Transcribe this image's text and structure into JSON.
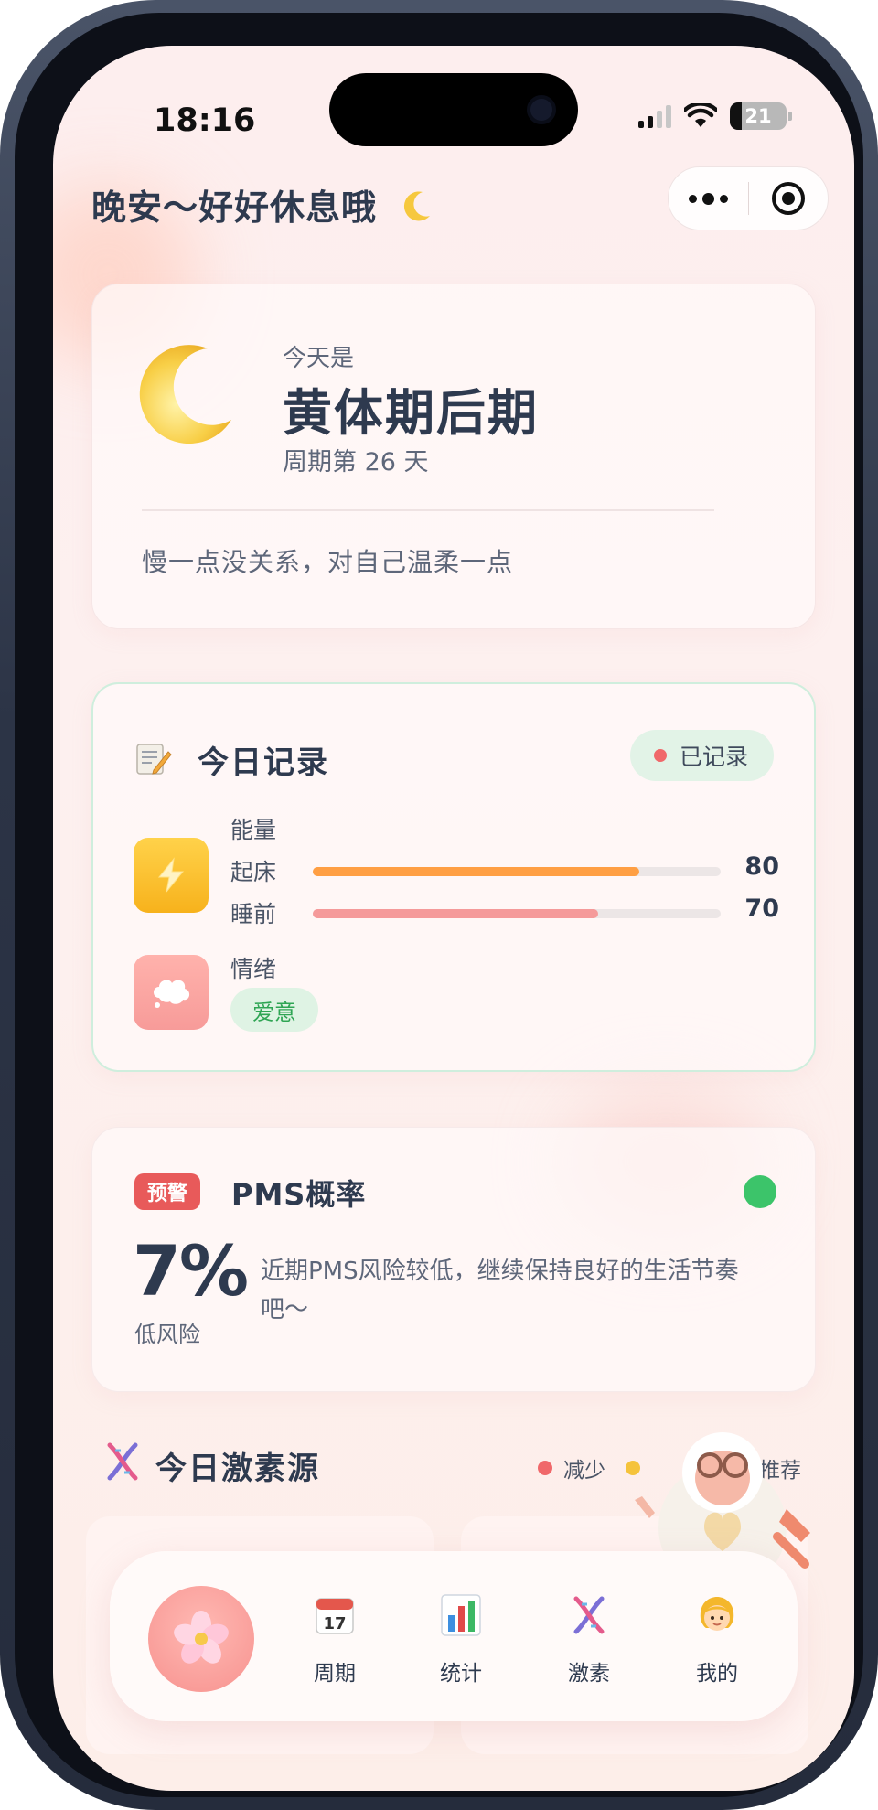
{
  "status_bar": {
    "time": "18:16",
    "battery": "21"
  },
  "header": {
    "greeting": "晚安～好好休息哦"
  },
  "phase": {
    "label": "今天是",
    "name": "黄体期后期",
    "day_text": "周期第 26 天",
    "quote": "慢一点没关系，对自己温柔一点"
  },
  "record": {
    "title": "今日记录",
    "badge": "已记录",
    "energy_label": "能量",
    "wake_label": "起床",
    "wake_value": "80",
    "sleep_label": "睡前",
    "sleep_value": "70",
    "mood_label": "情绪",
    "mood_value": "爱意",
    "energy_levels": {
      "wake": 80,
      "sleep": 70
    }
  },
  "pms": {
    "warn_tag": "预警",
    "title": "PMS概率",
    "percent": "7%",
    "risk": "低风险",
    "description": "近期PMS风险较低，继续保持良好的生活节奏吧～",
    "status_color": "#3cc46a"
  },
  "hormone": {
    "title": "今日激素源",
    "legend_reduce": "减少",
    "legend_recommend": "推荐"
  },
  "tabbar": {
    "tabs": [
      {
        "label": "周期",
        "icon": "calendar-icon"
      },
      {
        "label": "统计",
        "icon": "bar-chart-icon"
      },
      {
        "label": "激素",
        "icon": "dna-icon"
      },
      {
        "label": "我的",
        "icon": "girl-icon"
      }
    ]
  },
  "colors": {
    "accent": "#f79b99",
    "energy_bar": "#ff9f43",
    "sleep_bar": "#f59a9a",
    "recorded": "#3cc46a"
  }
}
